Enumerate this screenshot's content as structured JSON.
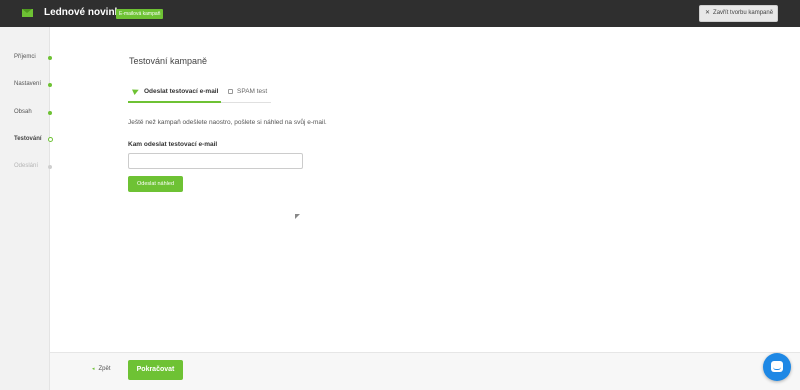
{
  "header": {
    "title": "Lednové novinky",
    "badge": "E-mailová kampaň",
    "close_label": "Zavřít tvorbu kampaně",
    "close_icon": "close-icon",
    "logo_icon": "email-logo-icon"
  },
  "sidebar": {
    "steps": [
      {
        "label": "Příjemci",
        "state": "done"
      },
      {
        "label": "Nastavení",
        "state": "done"
      },
      {
        "label": "Obsah",
        "state": "done"
      },
      {
        "label": "Testování",
        "state": "current"
      },
      {
        "label": "Odeslání",
        "state": "disabled"
      }
    ]
  },
  "main": {
    "title": "Testování kampaně",
    "tabs": [
      {
        "label": "Odeslat testovací e-mail",
        "icon": "send-icon",
        "active": true
      },
      {
        "label": "SPAM test",
        "icon": "spam-icon",
        "active": false
      }
    ],
    "intro": "Ještě než kampaň odešlete naostro, pošlete si náhled na svůj e-mail.",
    "email_label": "Kam odeslat testovací e-mail",
    "email_value": "",
    "email_placeholder": "",
    "send_button": "Odeslat náhled"
  },
  "footer": {
    "back_label": "Zpět",
    "continue_label": "Pokračovat"
  },
  "colors": {
    "accent": "#6ec234",
    "topbar": "#2f2f2f",
    "chat": "#1e88e5"
  }
}
